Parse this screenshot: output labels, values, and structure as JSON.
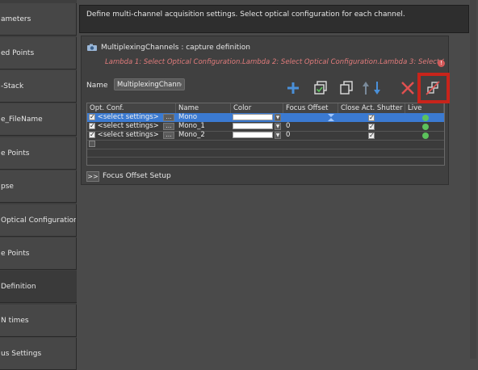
{
  "sidebar": {
    "items": [
      {
        "label": "ameters"
      },
      {
        "label": "ed Points"
      },
      {
        "label": "-Stack"
      },
      {
        "label": "e_FileName"
      },
      {
        "label": "e Points"
      },
      {
        "label": "pse"
      },
      {
        "label": "Optical Configuration"
      },
      {
        "label": "e Points"
      },
      {
        "label": " Definition"
      },
      {
        "label": "N times"
      },
      {
        "label": "us Settings"
      }
    ]
  },
  "description": "Define multi-channel acquisition settings. Select optical configuration for each channel.",
  "panel": {
    "title": "MultiplexingChannels  :  capture  definition",
    "lambda_text": "Lambda 1: Select Optical Configuration.Lambda 2: Select Optical Configuration.Lambda 3: Select Optic",
    "name_label": "Name",
    "name_value": "MultiplexingChannels",
    "footer_toggle": ">>",
    "footer_label": "Focus Offset Setup"
  },
  "toolbar": {
    "icons": [
      "add-icon",
      "copy-check-icon",
      "duplicate-icon",
      "move-up-icon",
      "move-down-icon",
      "delete-icon",
      "split-icon"
    ]
  },
  "grid": {
    "headers": [
      "Opt. Conf.",
      "Name",
      "Color",
      "Focus Offset",
      "Close Act. Shutter",
      "Live"
    ],
    "rows": [
      {
        "opt_conf": "<select settings>",
        "dots": "...",
        "name": "Mono",
        "focus_offset": "",
        "shutter": true,
        "selected": true
      },
      {
        "opt_conf": "<select settings>",
        "dots": "...",
        "name": "Mono_1",
        "focus_offset": "0",
        "shutter": true,
        "selected": false
      },
      {
        "opt_conf": "<select settings>",
        "dots": "...",
        "name": "Mono_2",
        "focus_offset": "0",
        "shutter": true,
        "selected": false
      }
    ]
  },
  "colors": {
    "accent": "#4a90d9",
    "highlight": "#c8241b",
    "warning": "#e07b7b"
  }
}
